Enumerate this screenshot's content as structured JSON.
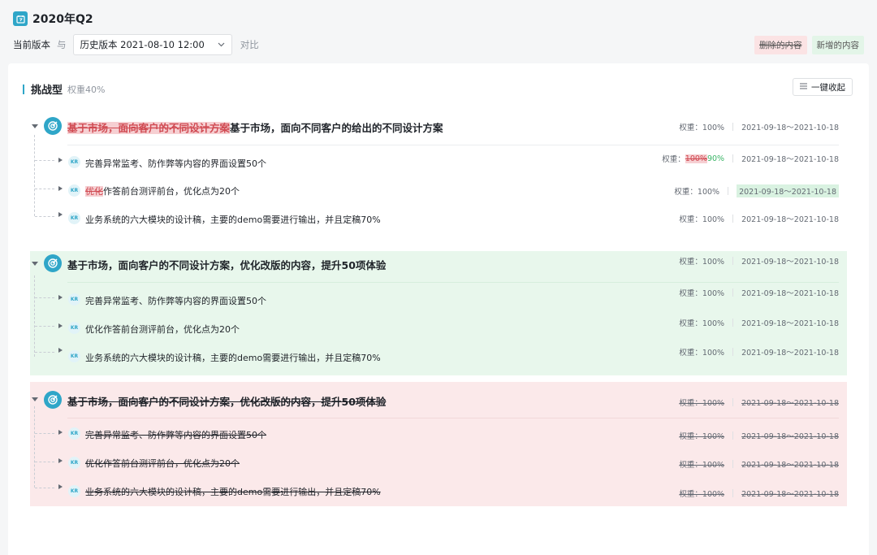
{
  "app": {
    "title": "2020年Q2"
  },
  "version_bar": {
    "current_label": "当前版本",
    "with_label": "与",
    "history_select": "历史版本 2021-08-10 12:00",
    "compare_label": "对比",
    "legend_deleted": "删除的内容",
    "legend_added": "新增的内容"
  },
  "section": {
    "title": "挑战型",
    "weight": "权重40%",
    "collapse_button": "一键收起"
  },
  "objectives": [
    {
      "state": "modified",
      "title_deleted": "基于市场，面向客户的不同设计方案",
      "title_rest": "基于市场，面向不同客户的给出的不同设计方案",
      "weight": "权重：100%",
      "date": "2021-09-18～2021-10-18",
      "krs": [
        {
          "label": "KR",
          "text": "完善异常监考、防作弊等内容的界面设置50个",
          "weight_prefix": "权重：",
          "weight_old": "100%",
          "weight_new": "90%",
          "date": "2021-09-18～2021-10-18"
        },
        {
          "label": "KR",
          "text_deleted": "优化",
          "text_rest": "作答前台测评前台，优化点为20个",
          "weight": "权重：100%",
          "date": "2021-09-18～2021-10-18"
        },
        {
          "label": "KR",
          "text": "业务系统的六大模块的设计稿，主要的demo需要进行输出，并且定稿70%",
          "weight": "权重：100%",
          "date": "2021-09-18～2021-10-18"
        }
      ]
    },
    {
      "state": "added",
      "title": "基于市场，面向客户的不同设计方案，优化改版的内容，提升50项体验",
      "weight": "权重：100%",
      "date": "2021-09-18～2021-10-18",
      "krs": [
        {
          "label": "KR",
          "text": "完善异常监考、防作弊等内容的界面设置50个",
          "weight": "权重：100%",
          "date": "2021-09-18～2021-10-18"
        },
        {
          "label": "KR",
          "text": "优化作答前台测评前台，优化点为20个",
          "weight": "权重：100%",
          "date": "2021-09-18～2021-10-18"
        },
        {
          "label": "KR",
          "text": "业务系统的六大模块的设计稿，主要的demo需要进行输出，并且定稿70%",
          "weight": "权重：100%",
          "date": "2021-09-18～2021-10-18"
        }
      ]
    },
    {
      "state": "deleted",
      "title": "基于市场，面向客户的不同设计方案，优化改版的内容，提升50项体验",
      "weight": "权重：100%",
      "date": "2021-09-18～2021-10-18",
      "krs": [
        {
          "label": "KR",
          "text": "完善异常监考、防作弊等内容的界面设置50个",
          "weight": "权重：100%",
          "date": "2021-09-18～2021-10-18"
        },
        {
          "label": "KR",
          "text": "优化作答前台测评前台，优化点为20个",
          "weight": "权重：100%",
          "date": "2021-09-18～2021-10-18"
        },
        {
          "label": "KR",
          "text": "业务系统的六大模块的设计稿，主要的demo需要进行输出，并且定稿70%",
          "weight": "权重：100%",
          "date": "2021-09-18～2021-10-18"
        }
      ]
    }
  ],
  "colors": {
    "accent": "#2fa6c8",
    "deleted_bg": "#fbe9ea",
    "added_bg": "#e8f7ec"
  },
  "icons": {
    "objective": "target-icon",
    "kr": "kr-badge",
    "collapse": "list-icon",
    "dropdown": "chevron-down-icon"
  }
}
